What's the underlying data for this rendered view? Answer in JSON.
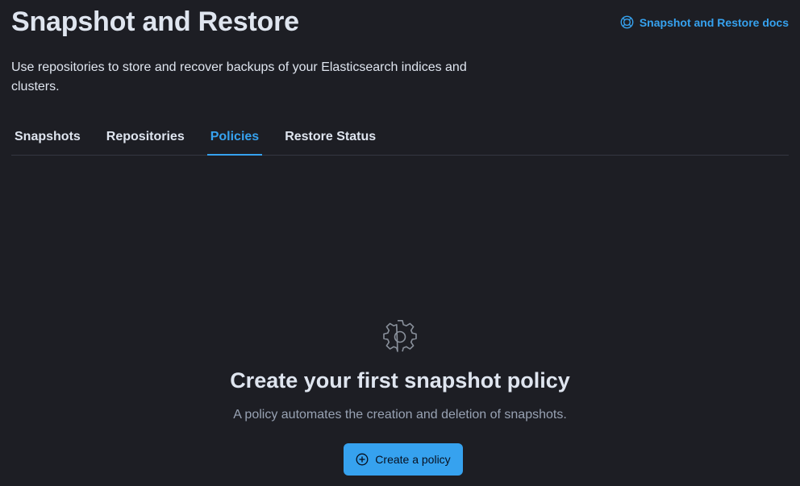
{
  "header": {
    "title": "Snapshot and Restore",
    "docs_link": "Snapshot and Restore docs",
    "description": "Use repositories to store and recover backups of your Elasticsearch indices and clusters."
  },
  "tabs": [
    {
      "label": "Snapshots",
      "selected": false
    },
    {
      "label": "Repositories",
      "selected": false
    },
    {
      "label": "Policies",
      "selected": true
    },
    {
      "label": "Restore Status",
      "selected": false
    }
  ],
  "empty_state": {
    "icon": "gear-icon",
    "title": "Create your first snapshot policy",
    "body": "A policy automates the creation and deletion of snapshots.",
    "button_label": "Create a policy",
    "button_icon": "plus-circle-icon"
  },
  "colors": {
    "background": "#1d1e24",
    "accent": "#36a2ef",
    "text": "#dfe5ef",
    "muted_text": "#98a2b3",
    "divider": "#343741"
  }
}
